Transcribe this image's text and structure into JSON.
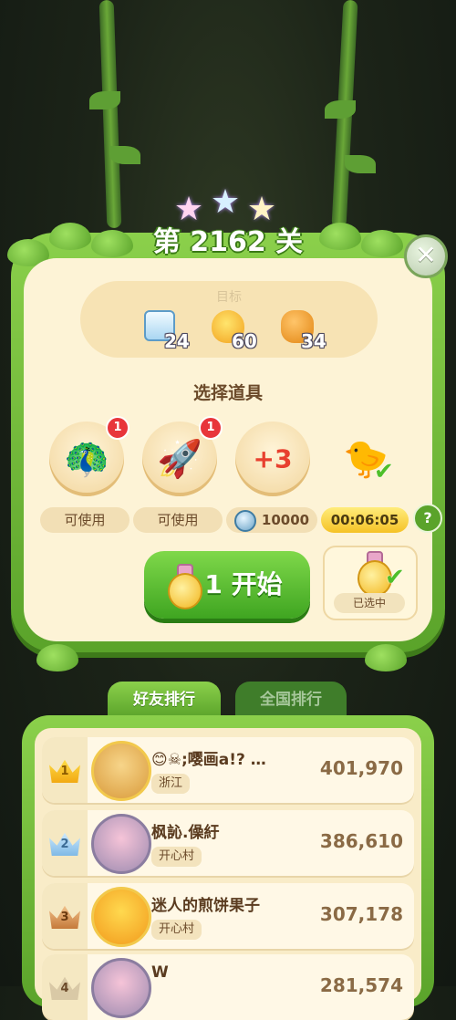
{
  "level": {
    "title": "第 2162 关"
  },
  "close": {
    "glyph": "✕"
  },
  "goals": {
    "label": "目标",
    "items": [
      {
        "icon": "ice-block-icon",
        "count": "24"
      },
      {
        "icon": "chick-icon",
        "count": "60"
      },
      {
        "icon": "orange-blob-icon",
        "count": "34"
      }
    ]
  },
  "boosters": {
    "title": "选择道具",
    "items": [
      {
        "icon": "rainbow-bird-icon",
        "glyph": "🦚",
        "badge": "1",
        "label": "可使用"
      },
      {
        "icon": "firework-rocket-icon",
        "glyph": "🚀",
        "badge": "1",
        "label": "可使用"
      },
      {
        "icon": "plus-three-moves-icon",
        "glyph": "+3",
        "label": "10000"
      },
      {
        "icon": "bird-pair-icon",
        "glyph": "🐤",
        "label": "00:06:05"
      }
    ],
    "help": "?"
  },
  "start": {
    "label": "1 开始"
  },
  "selected": {
    "label": "已选中"
  },
  "tabs": {
    "friends": "好友排行",
    "national": "全国排行"
  },
  "leaderboard": [
    {
      "rank": "1",
      "name": "😊☠;嘤画a!? …",
      "region": "浙江",
      "score": "401,970"
    },
    {
      "rank": "2",
      "name": "枫訫.僺紆",
      "region": "开心村",
      "score": "386,610"
    },
    {
      "rank": "3",
      "name": "迷人的煎饼果子",
      "region": "开心村",
      "score": "307,178"
    },
    {
      "rank": "4",
      "name": "W",
      "region": "",
      "score": "281,574"
    }
  ]
}
